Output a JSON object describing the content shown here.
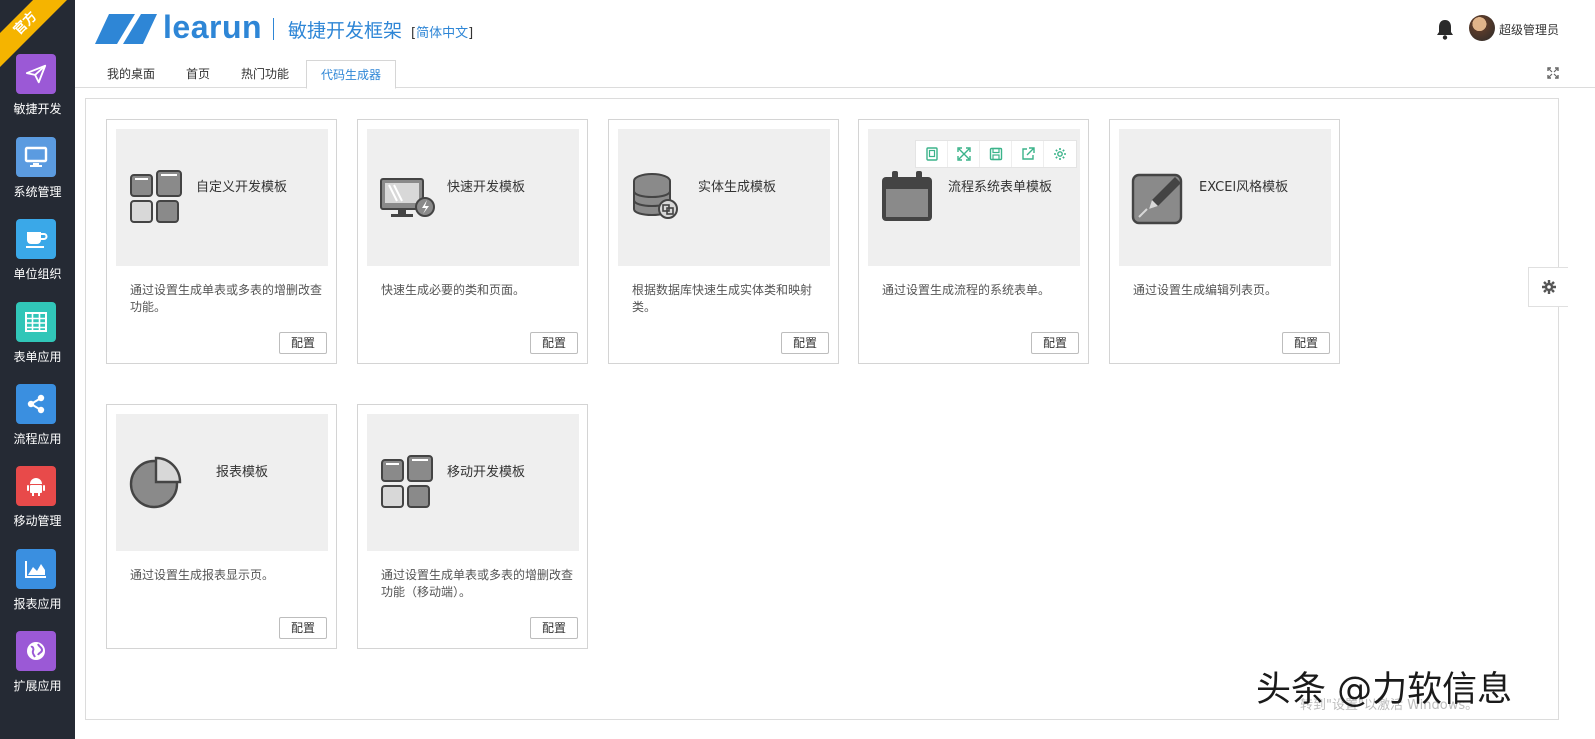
{
  "ribbon": "官方",
  "sidebar": {
    "items": [
      {
        "label": "敏捷开发",
        "icon": "paper-plane-icon",
        "color": "#9b59d6"
      },
      {
        "label": "系统管理",
        "icon": "monitor-icon",
        "color": "#5b9be0"
      },
      {
        "label": "单位组织",
        "icon": "coffee-icon",
        "color": "#3aa8e8"
      },
      {
        "label": "表单应用",
        "icon": "table-grid-icon",
        "color": "#31c6b8"
      },
      {
        "label": "流程应用",
        "icon": "share-nodes-icon",
        "color": "#3a8fe0"
      },
      {
        "label": "移动管理",
        "icon": "android-icon",
        "color": "#e84a4a"
      },
      {
        "label": "报表应用",
        "icon": "area-chart-icon",
        "color": "#3a8fe0"
      },
      {
        "label": "扩展应用",
        "icon": "globe-icon",
        "color": "#9b59d6"
      }
    ]
  },
  "header": {
    "logo_text": "learun",
    "app_title": "敏捷开发框架",
    "lang_open": "[",
    "lang": "简体中文",
    "lang_close": "]",
    "user_name": "超级管理员",
    "accent": "#2e86d6"
  },
  "tabs": [
    {
      "label": "我的桌面",
      "active": false
    },
    {
      "label": "首页",
      "active": false
    },
    {
      "label": "热门功能",
      "active": false
    },
    {
      "label": "代码生成器",
      "active": true
    }
  ],
  "cards": [
    {
      "title": "自定义开发模板",
      "desc": "通过设置生成单表或多表的增删改查功能。",
      "button": "配置",
      "icon": "grid-blocks-icon"
    },
    {
      "title": "快速开发模板",
      "desc": "快速生成必要的类和页面。",
      "button": "配置",
      "icon": "monitor-lightning-icon"
    },
    {
      "title": "实体生成模板",
      "desc": "根据数据库快速生成实体类和映射类。",
      "button": "配置",
      "icon": "database-icon"
    },
    {
      "title": "流程系统表单模板",
      "desc": "通过设置生成流程的系统表单。",
      "button": "配置",
      "icon": "calendar-icon"
    },
    {
      "title": "EXCEl风格模板",
      "desc": "通过设置生成编辑列表页。",
      "button": "配置",
      "icon": "edit-pencil-icon"
    },
    {
      "title": "报表模板",
      "desc": "通过设置生成报表显示页。",
      "button": "配置",
      "icon": "pie-chart-icon"
    },
    {
      "title": "移动开发模板",
      "desc": "通过设置生成单表或多表的增删改查功能（移动端）。",
      "button": "配置",
      "icon": "grid-blocks-icon"
    }
  ],
  "hover_toolbar": [
    "copy-icon",
    "expand-icon",
    "save-icon",
    "export-icon",
    "settings-icon"
  ],
  "watermark": "头条 @力软信息",
  "windows_notice": "转到\"设置\"以激活 Windows。"
}
